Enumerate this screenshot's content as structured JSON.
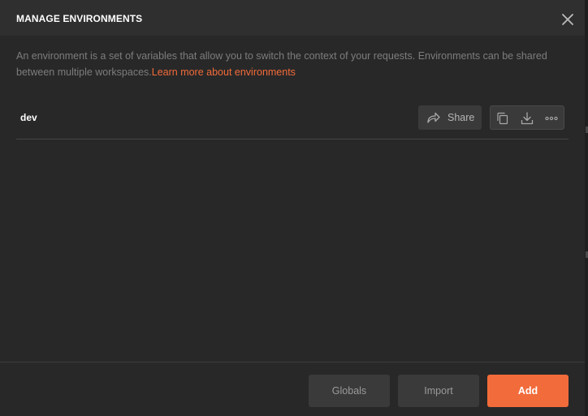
{
  "modal": {
    "title": "MANAGE ENVIRONMENTS",
    "description": "An environment is a set of variables that allow you to switch the context of your requests. Environments can be shared between multiple workspaces.",
    "learn_more_link": "Learn more about environments"
  },
  "environments": [
    {
      "name": "dev",
      "share_label": "Share"
    }
  ],
  "footer": {
    "globals_label": "Globals",
    "import_label": "Import",
    "add_label": "Add"
  },
  "icons": {
    "close": "close-icon",
    "share": "share-arrow-icon",
    "duplicate": "duplicate-icon",
    "download": "download-icon",
    "more": "more-options-icon"
  },
  "colors": {
    "accent": "#f26b3a",
    "background": "#282828",
    "header": "#2f2f2f"
  }
}
